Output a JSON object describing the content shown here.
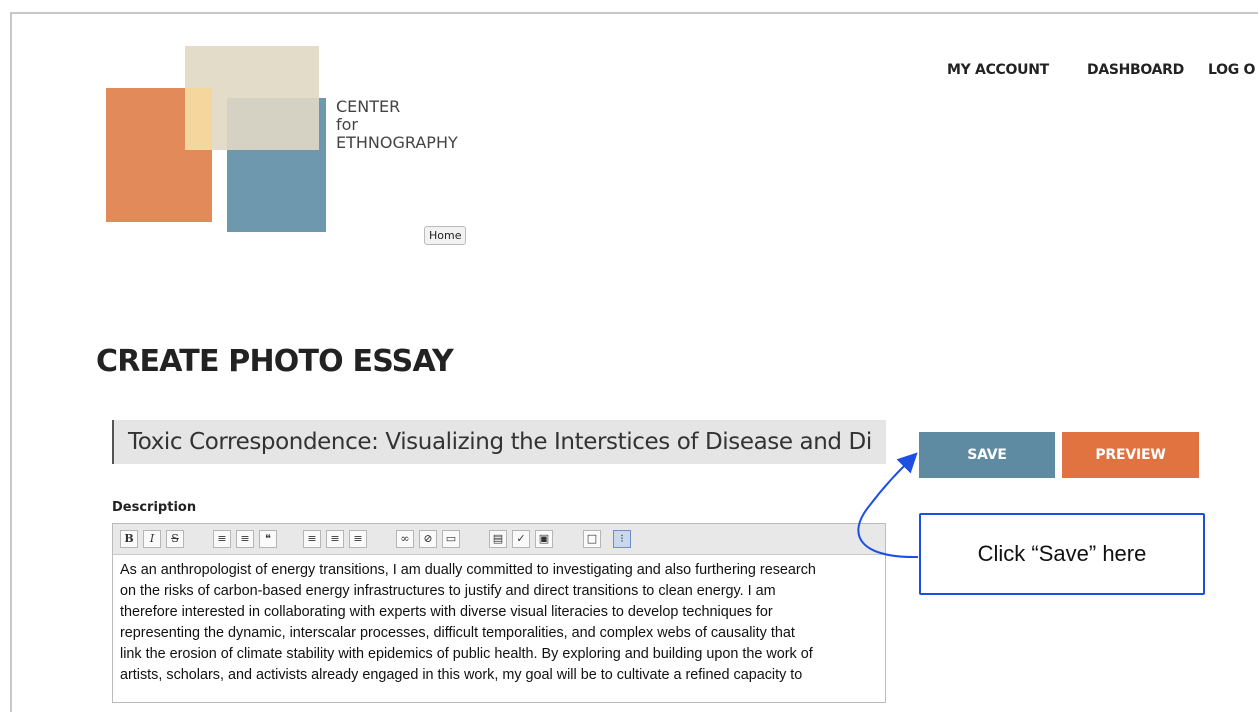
{
  "brand": {
    "line1": "CENTER",
    "line2": "for",
    "line3": "ETHNOGRAPHY"
  },
  "home_button": "Home",
  "nav": {
    "my_account": "MY ACCOUNT",
    "dashboard": "DASHBOARD",
    "logout": "LOG O"
  },
  "page_title": "CREATE PHOTO ESSAY",
  "title_field": {
    "value": "Toxic Correspondence: Visualizing the Interstices of Disease and Di"
  },
  "buttons": {
    "save": "SAVE",
    "preview": "PREVIEW"
  },
  "description_label": "Description",
  "toolbar": [
    {
      "icon": "bold-icon",
      "glyph": "B"
    },
    {
      "icon": "italic-icon",
      "glyph": "I"
    },
    {
      "icon": "strikethrough-icon",
      "glyph": "S"
    },
    {
      "icon": "bullet-list-icon",
      "glyph": "≡"
    },
    {
      "icon": "numbered-list-icon",
      "glyph": "≡"
    },
    {
      "icon": "blockquote-icon",
      "glyph": "❝"
    },
    {
      "icon": "align-left-icon",
      "glyph": "≡"
    },
    {
      "icon": "align-center-icon",
      "glyph": "≡"
    },
    {
      "icon": "align-right-icon",
      "glyph": "≡"
    },
    {
      "icon": "link-icon",
      "glyph": "∞"
    },
    {
      "icon": "unlink-icon",
      "glyph": "⊘"
    },
    {
      "icon": "page-break-icon",
      "glyph": "▭"
    },
    {
      "icon": "toggle-toolbar-icon",
      "glyph": "▤"
    },
    {
      "icon": "spellcheck-icon",
      "glyph": "✓"
    },
    {
      "icon": "insert-image-icon",
      "glyph": "▣"
    },
    {
      "icon": "fullscreen-icon",
      "glyph": "□"
    },
    {
      "icon": "kitchen-sink-icon",
      "glyph": "⁝"
    }
  ],
  "description_lines": [
    "As an anthropologist of energy transitions, I am dually committed to investigating and also furthering research",
    "on the risks of carbon-based energy infrastructures to justify and direct transitions to clean energy. I am",
    "therefore interested in collaborating with experts with diverse visual literacies to develop techniques for",
    "representing the dynamic, interscalar processes, difficult temporalities, and complex webs of causality that",
    "link the erosion of climate stability with epidemics of public health. By exploring and building upon the work of",
    "artists, scholars, and activists already engaged in this work, my goal will be to cultivate a refined capacity to"
  ],
  "callout": "Click “Save” here",
  "colors": {
    "save": "#5e8ba1",
    "preview": "#e0733f",
    "callout_border": "#1d4fe3"
  }
}
